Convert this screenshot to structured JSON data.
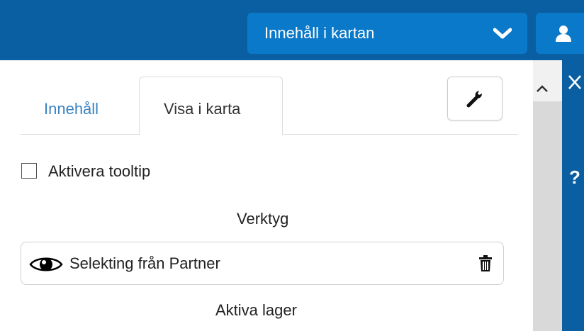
{
  "header": {
    "dropdown_label": "Innehåll i kartan",
    "dropdown_icon": "chevron-down-icon",
    "user_icon": "user-icon"
  },
  "side_strip": {
    "close_icon": "close-icon",
    "help_label": "?"
  },
  "tabs": [
    {
      "label": "Innehåll",
      "active": false
    },
    {
      "label": "Visa i karta",
      "active": true
    }
  ],
  "tools_button_icon": "wrench-icon",
  "tooltip_checkbox": {
    "label": "Aktivera tooltip",
    "checked": false
  },
  "sections": {
    "tools_title": "Verktyg",
    "active_layers_title": "Aktiva lager"
  },
  "layers": [
    {
      "name": "Selekting från Partner",
      "visible": true,
      "visibility_icon": "eye-icon",
      "delete_icon": "trash-icon"
    }
  ],
  "colors": {
    "header_bg": "#0a5fa3",
    "header_button": "#0b79c9",
    "active_tab_link": "#3a83c1",
    "scrollbar_track": "#d9d9d9"
  }
}
